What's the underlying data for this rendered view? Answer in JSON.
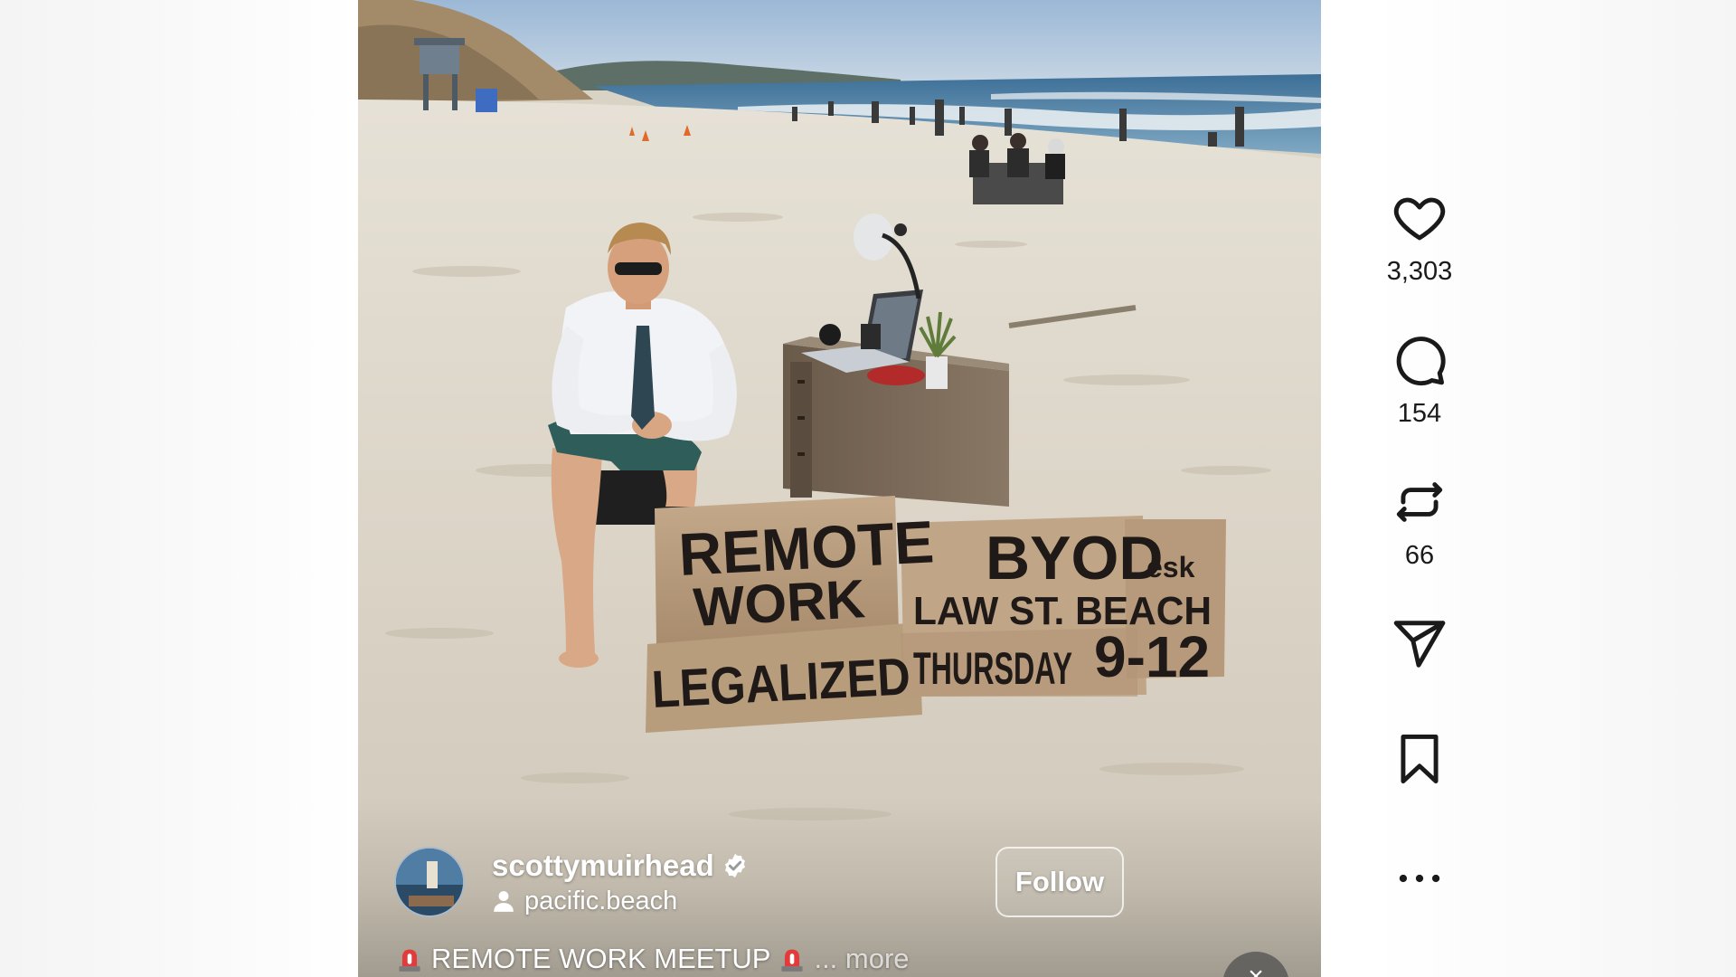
{
  "post": {
    "username": "scottymuirhead",
    "location": "pacific.beach",
    "follow_label": "Follow",
    "caption_text": "REMOTE WORK MEETUP",
    "more_label": "... more"
  },
  "signs": {
    "left_top": "REMOTE",
    "left_mid": "WORK",
    "left_bottom": "LEGALIZED",
    "right_line1": "BYOD",
    "right_line1_suffix": "esk",
    "right_line2": "LAW ST. BEACH",
    "right_line3_day": "THURSDAY",
    "right_line3_time": "9-12"
  },
  "actions": {
    "likes": "3,303",
    "comments": "154",
    "reposts": "66"
  },
  "icons": {
    "like": "heart-icon",
    "comment": "comment-bubble-icon",
    "repost": "repost-icon",
    "share": "paper-plane-icon",
    "save": "bookmark-icon",
    "more": "more-horizontal-icon",
    "verified": "verified-badge-icon",
    "location": "person-icon",
    "caption_emoji": "rotating-light-icon"
  },
  "colors": {
    "verified_blue": "#3897f0",
    "icon_dark": "#1a1a1a",
    "sand": "#dcd6ca",
    "sky": "#a9c2dc",
    "ocean": "#4a7fa6"
  }
}
